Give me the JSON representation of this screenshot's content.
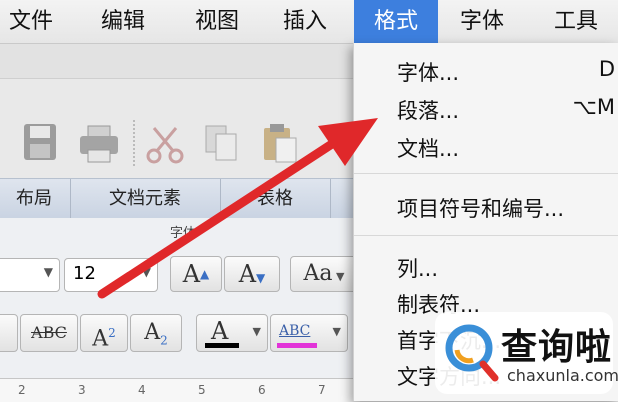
{
  "menubar": {
    "items": [
      "文件",
      "编辑",
      "视图",
      "插入",
      "格式",
      "字体",
      "工具"
    ],
    "active_index": 4,
    "active_color": "#3d7fde"
  },
  "ribbon": {
    "tabs": [
      "布局",
      "文档元素",
      "表格"
    ],
    "group_label": "字体"
  },
  "font_panel": {
    "font_size_value": "12"
  },
  "ruler": {
    "marks": [
      "2",
      "3",
      "4",
      "5",
      "6",
      "7"
    ]
  },
  "format_menu": {
    "items": [
      {
        "label": "字体...",
        "shortcut": "D"
      },
      {
        "label": "段落...",
        "shortcut": "⌥M"
      },
      {
        "label": "文档...",
        "shortcut": ""
      },
      {
        "label": "项目符号和编号...",
        "shortcut": ""
      },
      {
        "label": "列...",
        "shortcut": ""
      },
      {
        "label": "制表符...",
        "shortcut": ""
      },
      {
        "label": "首字下沉...",
        "shortcut": ""
      },
      {
        "label": "文字方向...",
        "shortcut": ""
      }
    ]
  },
  "watermark": {
    "cn": "查询啦",
    "en": "chaxunla.com"
  },
  "arrow_color": "#e0282a"
}
